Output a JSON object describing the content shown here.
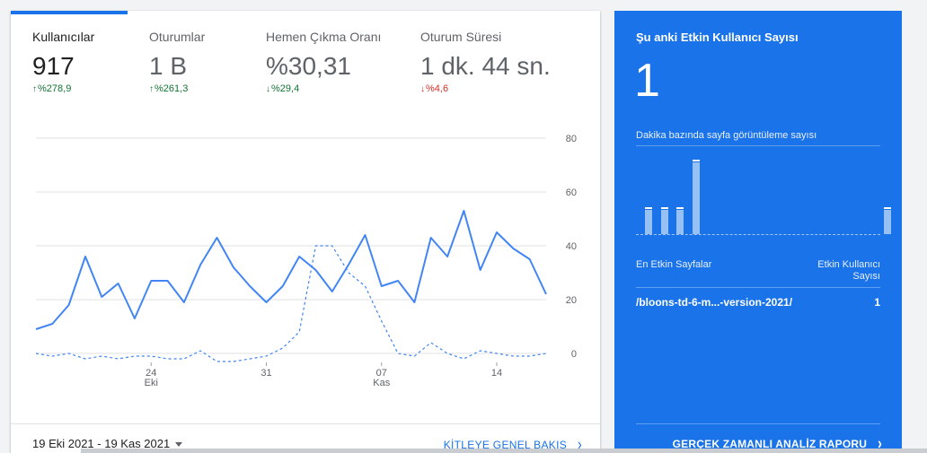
{
  "metrics": [
    {
      "label": "Kullanıcılar",
      "value": "917",
      "change": "%278,9",
      "direction": "up",
      "tone": "good",
      "active": true
    },
    {
      "label": "Oturumlar",
      "value": "1 B",
      "change": "%261,3",
      "direction": "up",
      "tone": "good",
      "active": false
    },
    {
      "label": "Hemen Çıkma Oranı",
      "value": "%30,31",
      "change": "%29,4",
      "direction": "down",
      "tone": "good",
      "active": false
    },
    {
      "label": "Oturum Süresi",
      "value": "1 dk. 44 sn.",
      "change": "%4,6",
      "direction": "down",
      "tone": "bad",
      "active": false
    }
  ],
  "chart_data": {
    "type": "line",
    "y_ticks": [
      0,
      20,
      40,
      60,
      80
    ],
    "ylim": [
      0,
      80
    ],
    "x_ticks": [
      {
        "index": 7,
        "label": "24",
        "sublabel": "Eki"
      },
      {
        "index": 14,
        "label": "31",
        "sublabel": ""
      },
      {
        "index": 21,
        "label": "07",
        "sublabel": "Kas"
      },
      {
        "index": 28,
        "label": "14",
        "sublabel": ""
      }
    ],
    "grid": true,
    "series": [
      {
        "style": "solid",
        "color": "#4285f4",
        "values": [
          9,
          11,
          18,
          36,
          21,
          26,
          13,
          27,
          27,
          19,
          33,
          43,
          32,
          25,
          19,
          25,
          36,
          31,
          23,
          33,
          44,
          25,
          27,
          19,
          43,
          36,
          53,
          31,
          45,
          39,
          35,
          22
        ]
      },
      {
        "style": "dashed",
        "color": "#4285f4",
        "values": [
          0,
          -1,
          0,
          -2,
          -1,
          -2,
          -1,
          -1,
          -2,
          -2,
          1,
          -3,
          -3,
          -2,
          -1,
          2,
          8,
          40,
          40,
          30,
          25,
          12,
          0,
          -1,
          4,
          0,
          -2,
          1,
          0,
          -1,
          -1,
          0
        ]
      }
    ]
  },
  "footer": {
    "date_range": "19 Eki 2021 - 19 Kas 2021",
    "overview_link": "KİTLEYE GENEL BAKIŞ"
  },
  "realtime": {
    "title": "Şu anki Etkin Kullanıcı Sayısı",
    "count": "1",
    "subtitle": "Dakika bazında sayfa görüntüleme sayısı",
    "bars": [
      1,
      1,
      1,
      3,
      0,
      0,
      0,
      0,
      0,
      0,
      0,
      0,
      0,
      0,
      0,
      1
    ],
    "bar_max": 3,
    "top_pages_header": "En Etkin Sayfalar",
    "users_header_line1": "Etkin Kullanıcı",
    "users_header_line2": "Sayısı",
    "page_path": "/bloons-td-6-m...-version-2021/",
    "page_users": "1",
    "report_link": "GERÇEK ZAMANLI ANALİZ RAPORU"
  }
}
